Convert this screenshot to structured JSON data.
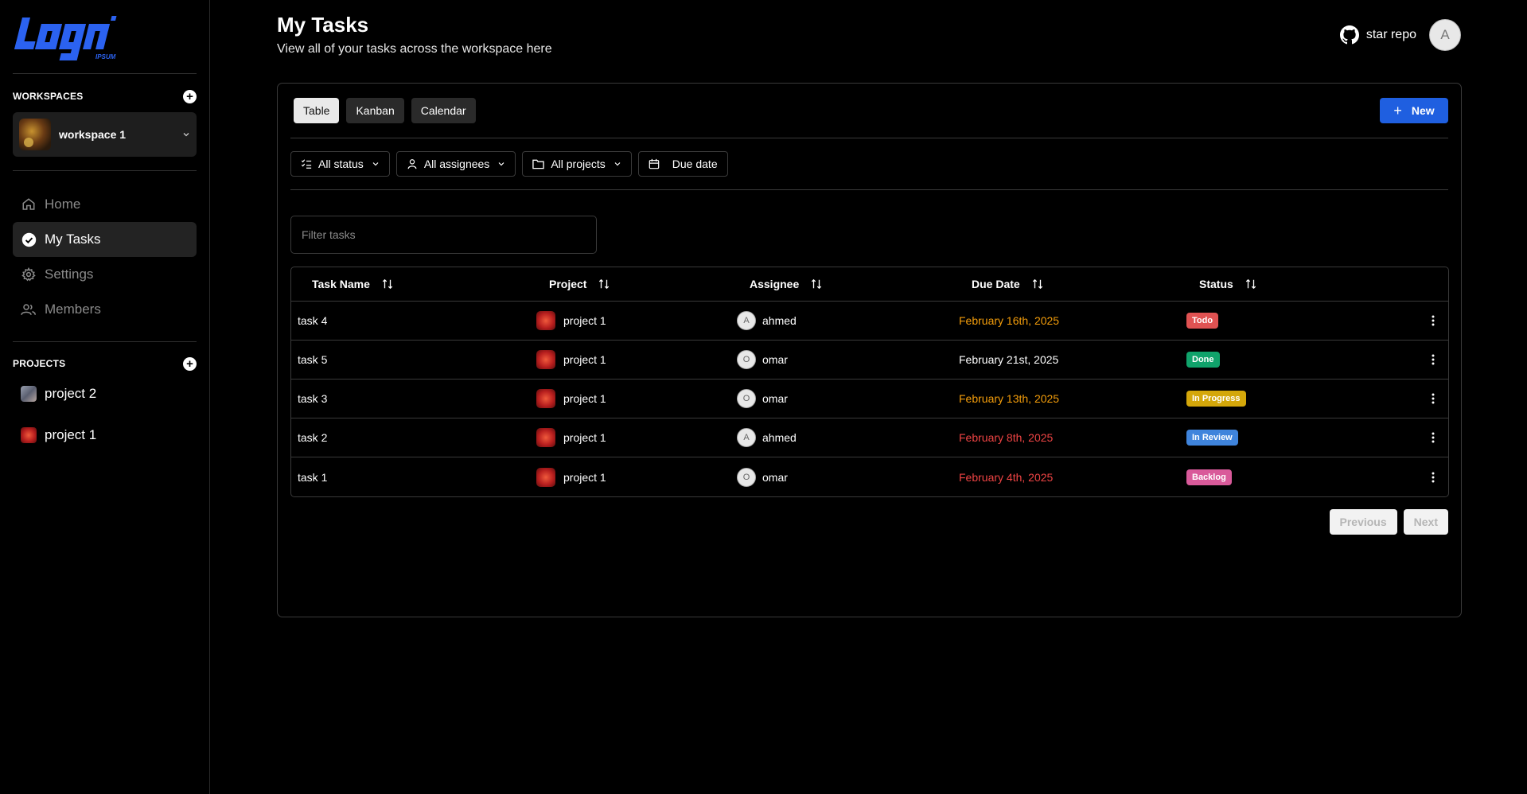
{
  "sidebar": {
    "logo_brand": "LOGO",
    "logo_sub": "IPSUM",
    "workspaces_title": "WORKSPACES",
    "workspace_name": "workspace 1",
    "nav": [
      {
        "label": "Home",
        "icon": "home-icon"
      },
      {
        "label": "My Tasks",
        "icon": "check-circle-icon",
        "active": true
      },
      {
        "label": "Settings",
        "icon": "gear-icon"
      },
      {
        "label": "Members",
        "icon": "users-icon"
      }
    ],
    "projects_title": "PROJECTS",
    "projects": [
      {
        "label": "project 2"
      },
      {
        "label": "project 1"
      }
    ]
  },
  "header": {
    "title": "My Tasks",
    "subtitle": "View all of your tasks across the workspace here",
    "github_label": "star repo",
    "user_initial": "A"
  },
  "views": {
    "tabs": [
      {
        "label": "Table",
        "active": true
      },
      {
        "label": "Kanban"
      },
      {
        "label": "Calendar"
      }
    ],
    "new_label": "New"
  },
  "filters": {
    "status": "All status",
    "assignees": "All assignees",
    "projects": "All projects",
    "due_date": "Due date"
  },
  "search": {
    "placeholder": "Filter tasks"
  },
  "table": {
    "columns": [
      "Task Name",
      "Project",
      "Assignee",
      "Due Date",
      "Status"
    ],
    "rows": [
      {
        "task": "task 4",
        "project": "project 1",
        "assignee_initial": "A",
        "assignee": "ahmed",
        "due": "February 16th, 2025",
        "status": "Todo"
      },
      {
        "task": "task 5",
        "project": "project 1",
        "assignee_initial": "O",
        "assignee": "omar",
        "due": "February 21st, 2025",
        "status": "Done"
      },
      {
        "task": "task 3",
        "project": "project 1",
        "assignee_initial": "O",
        "assignee": "omar",
        "due": "February 13th, 2025",
        "status": "In Progress"
      },
      {
        "task": "task 2",
        "project": "project 1",
        "assignee_initial": "A",
        "assignee": "ahmed",
        "due": "February 8th, 2025",
        "status": "In Review"
      },
      {
        "task": "task 1",
        "project": "project 1",
        "assignee_initial": "O",
        "assignee": "omar",
        "due": "February 4th, 2025",
        "status": "Backlog"
      }
    ]
  },
  "pagination": {
    "previous": "Previous",
    "next": "Next"
  },
  "colors": {
    "accent": "#1f5fe0",
    "logo": "#2b62f0",
    "due_orange": "#f59e0b",
    "due_red": "#ef4444",
    "due_normal": "#ffffff",
    "status_todo": "#e05252",
    "status_done": "#10a36b",
    "status_in_progress": "#d4a70a",
    "status_in_review": "#3f84dc",
    "status_backlog": "#d95a9a"
  }
}
